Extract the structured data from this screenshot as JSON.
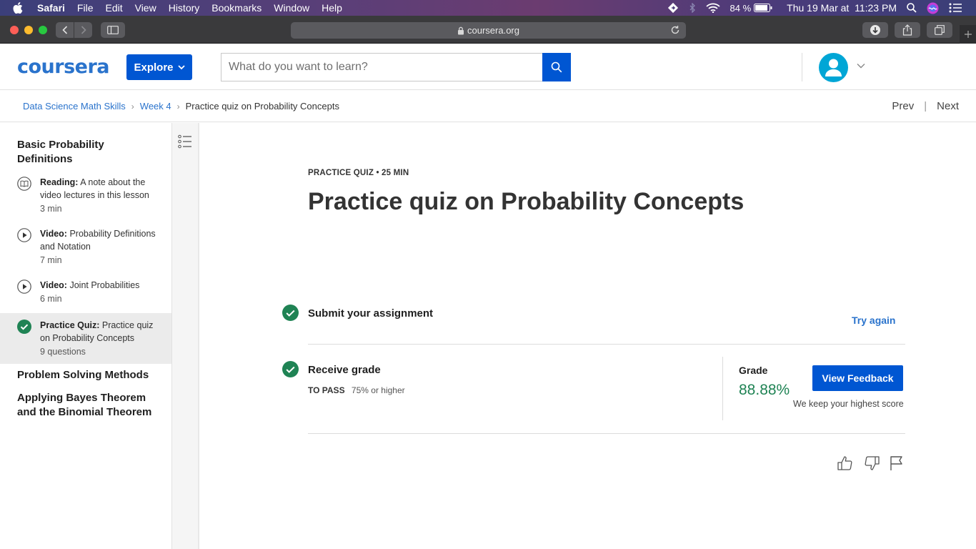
{
  "menubar": {
    "app": "Safari",
    "items": [
      "File",
      "Edit",
      "View",
      "History",
      "Bookmarks",
      "Window",
      "Help"
    ],
    "battery": "84 %",
    "datetime": "Thu 19 Mar at  11:23 PM"
  },
  "browser": {
    "url": "coursera.org"
  },
  "header": {
    "logo": "coursera",
    "explore_label": "Explore",
    "search_placeholder": "What do you want to learn?"
  },
  "breadcrumb": {
    "items": [
      "Data Science Math Skills",
      "Week 4"
    ],
    "current": "Practice quiz on Probability Concepts",
    "prev": "Prev",
    "next": "Next"
  },
  "sidebar": {
    "section1_title": "Basic Probability Definitions",
    "lessons": [
      {
        "type": "Reading:",
        "title": "A note about the video lectures in this lesson",
        "meta": "3 min",
        "icon": "book-icon"
      },
      {
        "type": "Video:",
        "title": "Probability Definitions and Notation",
        "meta": "7 min",
        "icon": "play-icon"
      },
      {
        "type": "Video:",
        "title": "Joint Probabilities",
        "meta": "6 min",
        "icon": "play-icon"
      },
      {
        "type": "Practice Quiz:",
        "title": "Practice quiz on Probability Concepts",
        "meta": "9 questions",
        "icon": "check-circle-icon"
      }
    ],
    "section2_title": "Problem Solving Methods",
    "section3_title": "Applying Bayes Theorem and the Binomial Theorem"
  },
  "main": {
    "kicker": "PRACTICE QUIZ • 25 MIN",
    "title": "Practice quiz on Probability Concepts",
    "step1_label": "Submit your assignment",
    "try_again": "Try again",
    "step2_label": "Receive grade",
    "to_pass_label": "TO PASS",
    "to_pass_value": "75% or higher",
    "grade_label": "Grade",
    "grade_value": "88.88%",
    "view_feedback": "View Feedback",
    "keep_note": "We keep your highest score"
  },
  "colors": {
    "brand_blue": "#0056d2",
    "link_blue": "#2a73cc",
    "success_green": "#1f8354"
  }
}
